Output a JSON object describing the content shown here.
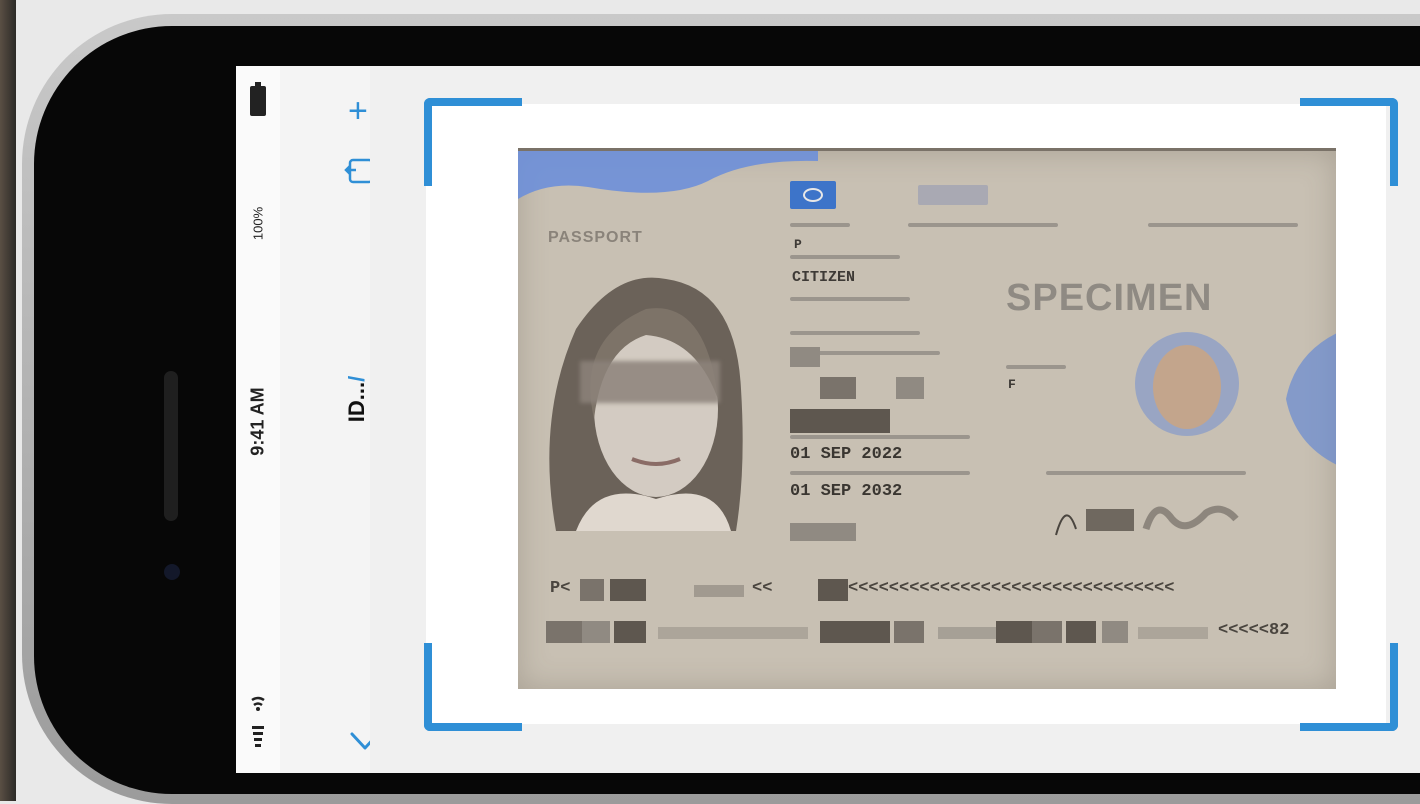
{
  "status_bar": {
    "time": "9:41 AM",
    "battery_percent": "100%",
    "icons": [
      "battery-icon",
      "wifi-icon",
      "signal-icon"
    ]
  },
  "toolbar": {
    "add_icon": "plus-icon",
    "share_icon": "share-icon",
    "document_title": "ID...",
    "edit_icon": "pencil-icon",
    "collapse_icon": "chevron-down-icon"
  },
  "scanner": {
    "frame_color": "#2f8fd6",
    "document": {
      "header": "PASSPORT",
      "type_code": "P",
      "nationality": "CITIZEN",
      "watermark": "SPECIMEN",
      "sex": "F",
      "date_of_issue": "01 SEP 2022",
      "date_of_expiry": "01 SEP 2032",
      "mrz_line1_prefix": "P<",
      "mrz_line1_mid": "<<",
      "mrz_line1_fill": "<<<<<<<<<<<<<<<<<<<<<<<<<<<<<<<<",
      "mrz_line2_end": "<<<<<82"
    }
  },
  "colors": {
    "accent": "#2f8fd6",
    "passport_paper": "#c8c0b3"
  }
}
